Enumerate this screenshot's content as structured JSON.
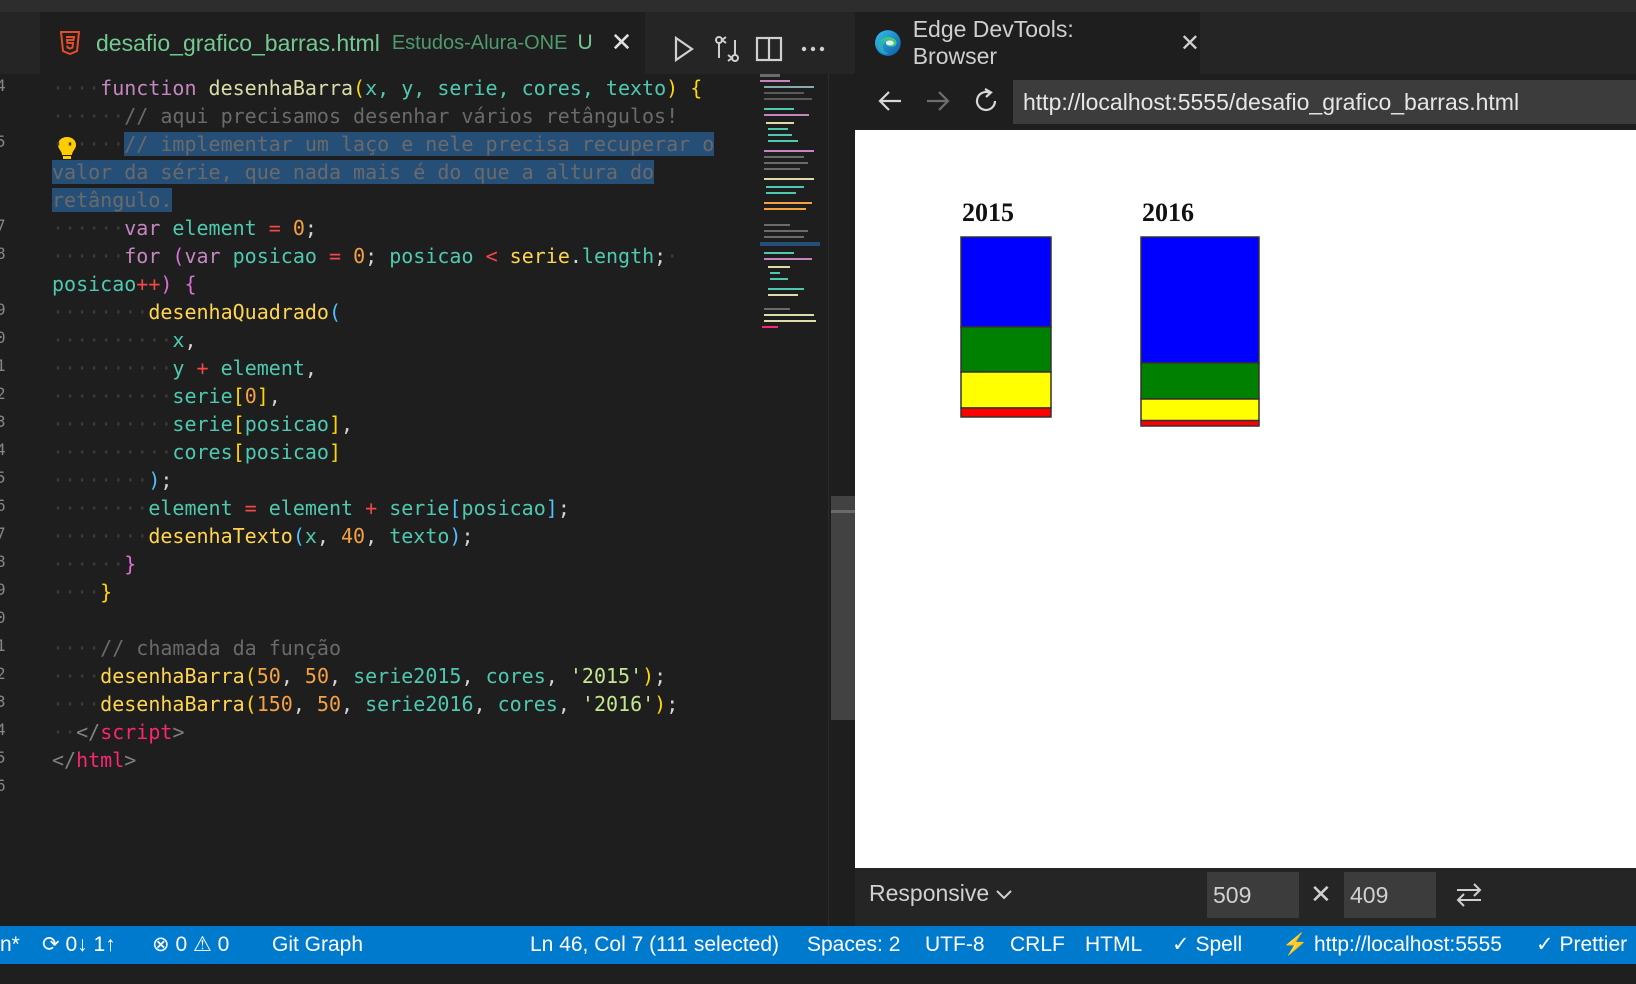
{
  "editor": {
    "tab": {
      "filename": "desafio_grafico_barras.html",
      "folder": "Estudos-Alura-ONE",
      "status": "U",
      "icon": "html5-icon"
    },
    "actions": [
      "run-icon",
      "compare-changes-icon",
      "split-editor-icon",
      "more-actions-icon"
    ],
    "gutter": [
      "4",
      "5",
      "7",
      "8",
      "9",
      "0",
      "1",
      "2",
      "3",
      "4",
      "5",
      "6",
      "7",
      "8",
      "9",
      "0",
      "1",
      "2",
      "3",
      "4",
      "5",
      "6"
    ],
    "code": {
      "l1_kw": "function",
      "l1_fn": "desenhaBarra",
      "l1_args": "x, y, serie, cores, texto",
      "l2_cmt": "// aqui precisamos desenhar vários retângulos!",
      "l3_cmt": "// implementar um laço e nele precisa recuperar o",
      "l4_cmt": "valor da série, que nada mais é do que a altura do",
      "l5_cmt": "retângulo.",
      "l6_kw": "var",
      "l6_var": "element",
      "l6_num": "0",
      "l7_kw": "for",
      "l7_kw2": "var",
      "l7_var": "posicao",
      "l7_num": "0",
      "l7_var2": "posicao",
      "l7_var3": "serie",
      "l7_prop": "length",
      "l8_var": "posicao",
      "l9_fn": "desenhaQuadrado",
      "l10_var": "x",
      "l11_var": "y",
      "l11_var2": "element",
      "l12_var": "serie",
      "l12_num": "0",
      "l13_var": "serie",
      "l13_idx": "posicao",
      "l14_var": "cores",
      "l14_idx": "posicao",
      "l16_var": "element",
      "l16_var2": "element",
      "l16_var3": "serie",
      "l16_idx": "posicao",
      "l17_fn": "desenhaTexto",
      "l17_var": "x",
      "l17_num": "40",
      "l17_var2": "texto",
      "l21_cmt": "// chamada da função",
      "l22_fn": "desenhaBarra",
      "l22_n1": "50",
      "l22_n2": "50",
      "l22_v1": "serie2015",
      "l22_v2": "cores",
      "l22_str": "'2015'",
      "l23_fn": "desenhaBarra",
      "l23_n1": "150",
      "l23_n2": "50",
      "l23_v1": "serie2016",
      "l23_v2": "cores",
      "l23_str": "'2016'",
      "l24_tag": "script",
      "l25_tag": "html"
    }
  },
  "browser": {
    "tab_title": "Edge DevTools: Browser",
    "url": "http://localhost:5555/desafio_grafico_barras.html",
    "device": "Responsive",
    "width": "509",
    "height": "409"
  },
  "chart_data": {
    "type": "bar",
    "stacked": true,
    "categories": [
      "2015",
      "2016"
    ],
    "series_colors": [
      "#0000ff",
      "#008000",
      "#ffff00",
      "#ff0000"
    ],
    "series": [
      {
        "values": [
          50,
          70
        ]
      },
      {
        "values": [
          25,
          20
        ]
      },
      {
        "values": [
          20,
          12
        ]
      },
      {
        "values": [
          5,
          3
        ]
      }
    ],
    "ylim": [
      0,
      100
    ]
  },
  "statusbar": {
    "remote": "n*",
    "sync": "0↓ 1↑",
    "errors": "0",
    "warnings": "0",
    "git_graph": "Git Graph",
    "position": "Ln 46, Col 7 (111 selected)",
    "spaces": "Spaces: 2",
    "encoding": "UTF-8",
    "eol": "CRLF",
    "language": "HTML",
    "spell": "Spell",
    "live_server": "http://localhost:5555",
    "prettier": "Prettier"
  },
  "colors": {
    "accent": "#007acc",
    "tab_modified": "#73c991"
  }
}
